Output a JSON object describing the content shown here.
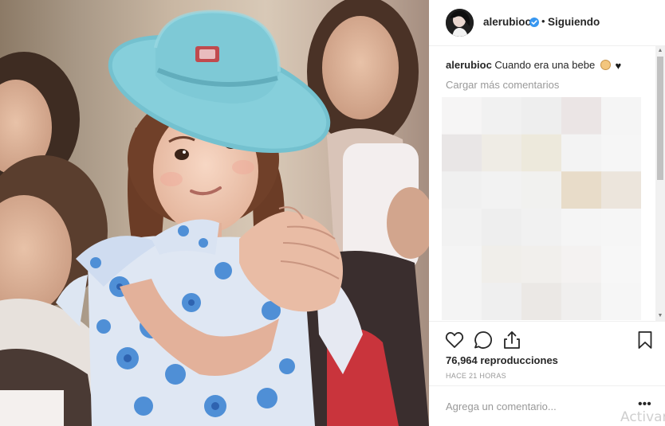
{
  "post": {
    "username": "alerubioc",
    "follow_status": "Siguiendo",
    "separator": "•"
  },
  "caption": {
    "username": "alerubioc",
    "text": "Cuando era una bebe"
  },
  "load_more": "Cargar más comentarios",
  "stats": {
    "views": "76,964 reproducciones",
    "time_ago": "HACE 21 HORAS"
  },
  "comment_box": {
    "placeholder": "Agrega un comentario...",
    "more": "•••"
  },
  "watermark": "Activar",
  "icons": {
    "like": "heart-icon",
    "comment": "comment-icon",
    "share": "share-icon",
    "save": "bookmark-icon",
    "verified": "verified-badge-icon"
  },
  "colors": {
    "verified_blue": "#3897f0",
    "muted_text": "#999999",
    "divider": "#efefef",
    "hat": "#7ec9d6",
    "dress_blue": "#4f8fd6"
  },
  "mosaic_colors": [
    [
      "#f6f5f5",
      "#f1f1f1",
      "#eeeeee",
      "#ebe5e5",
      "#f5f5f5"
    ],
    [
      "#e9e6e6",
      "#efece5",
      "#ede9dc",
      "#f3f3f3",
      "#f6f6f6"
    ],
    [
      "#f0f0f0",
      "#f2f2f2",
      "#f1f1ef",
      "#e8dcc9",
      "#ece5dc"
    ],
    [
      "#f2f2f2",
      "#eeeeee",
      "#f1f1f1",
      "#f5f5f5",
      "#f6f6f6"
    ],
    [
      "#f4f4f4",
      "#f0eeea",
      "#f1efec",
      "#f4f2f1",
      "#f7f7f7"
    ],
    [
      "#f4f4f4",
      "#efefef",
      "#ebe8e5",
      "#f0efee",
      "#f6f6f6"
    ]
  ]
}
